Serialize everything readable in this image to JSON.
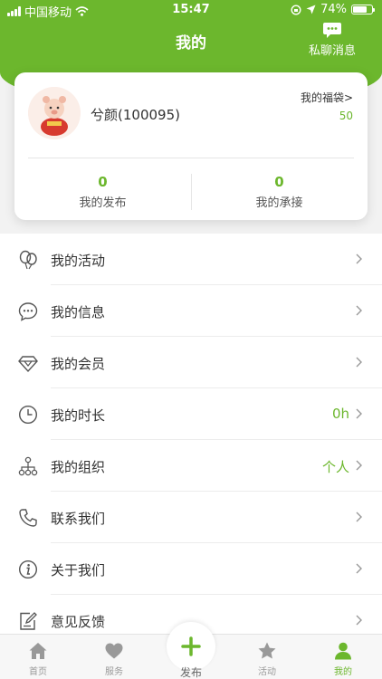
{
  "status_bar": {
    "carrier": "中国移动",
    "time": "15:47",
    "battery": "74%",
    "battery_level": 0.74
  },
  "header": {
    "title": "我的",
    "private_message_label": "私聊消息"
  },
  "profile": {
    "name": "兮颜(100095)",
    "luckybag_label": "我的福袋>",
    "luckybag_count": "50",
    "stats": [
      {
        "value": "0",
        "label": "我的发布"
      },
      {
        "value": "0",
        "label": "我的承接"
      }
    ]
  },
  "menu": {
    "items": [
      {
        "label": "我的活动",
        "value": "",
        "icon": "balloon-icon"
      },
      {
        "label": "我的信息",
        "value": "",
        "icon": "chat-bubble-icon"
      },
      {
        "label": "我的会员",
        "value": "",
        "icon": "diamond-icon"
      },
      {
        "label": "我的时长",
        "value": "0h",
        "icon": "clock-icon"
      },
      {
        "label": "我的组织",
        "value": "个人",
        "icon": "org-chart-icon"
      },
      {
        "label": "联系我们",
        "value": "",
        "icon": "phone-icon"
      },
      {
        "label": "关于我们",
        "value": "",
        "icon": "info-icon"
      },
      {
        "label": "意见反馈",
        "value": "",
        "icon": "feedback-icon"
      }
    ]
  },
  "tabbar": {
    "tabs": [
      {
        "label": "首页",
        "icon": "home-icon"
      },
      {
        "label": "服务",
        "icon": "heart-icon"
      },
      {
        "label": "发布",
        "icon": "plus-icon"
      },
      {
        "label": "活动",
        "icon": "star-icon"
      },
      {
        "label": "我的",
        "icon": "person-icon"
      }
    ],
    "active_index": 4
  },
  "colors": {
    "accent": "#6cb72d",
    "background": "#f2f2f2",
    "card": "#ffffff"
  }
}
